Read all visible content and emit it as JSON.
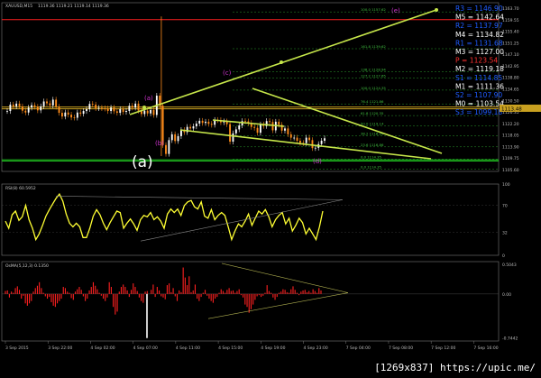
{
  "chart_data": [
    {
      "type": "candlestick",
      "panel": "price",
      "title": "XAUUSD,M15",
      "subtitle": "1119.36 1119.21 1119.14 1119.36",
      "ylim": [
        1105.0,
        1160.0
      ],
      "ticks_y": [
        "1163.70",
        "1159.55",
        "1155.40",
        "1151.25",
        "1147.10",
        "1142.95",
        "1138.80",
        "1134.65",
        "1130.50",
        "1126.35",
        "1122.20",
        "1118.05",
        "1113.90",
        "1109.75",
        "1105.60"
      ],
      "price_tag": "1113.48",
      "pivot_levels": [
        {
          "label": "R3 = 1146.90",
          "value": 1150.5,
          "color": "#1f5cff"
        },
        {
          "label": "M5 = 1142.64",
          "value": 1146.0,
          "color": "#ffffff"
        },
        {
          "label": "R2 = 1137.97",
          "value": 1141.3,
          "color": "#1f5cff"
        },
        {
          "label": "M4 = 1134.82",
          "value": 1138.0,
          "color": "#ffffff"
        },
        {
          "label": "R1 = 1131.68",
          "value": 1134.3,
          "color": "#1f5cff"
        },
        {
          "label": "M3 = 1127.00",
          "value": 1129.9,
          "color": "#ffffff"
        },
        {
          "label": "P = 1123.54",
          "value": 1126.5,
          "color": "#ff3030"
        },
        {
          "label": "M2 = 1119.18",
          "value": 1122.4,
          "color": "#ffffff"
        },
        {
          "label": "S1 = 1114.85",
          "value": 1118.6,
          "color": "#1f5cff"
        },
        {
          "label": "M1 = 1111.36",
          "value": 1114.4,
          "color": "#ffffff"
        },
        {
          "label": "S2 = 1107.90",
          "value": 1110.5,
          "color": "#1f5cff"
        },
        {
          "label": "M0 = 1103.54",
          "value": 1106.7,
          "color": "#ffffff"
        },
        {
          "label": "S3 = 1099.18",
          "value": 1102.7,
          "color": "#1f5cff"
        }
      ],
      "fib_levels": [
        {
          "label": "100.0 1157.62",
          "value": 1157.0
        },
        {
          "label": "161.8 1139.62",
          "value": 1145.0
        },
        {
          "label": "138.2 1128.94",
          "value": 1137.5
        },
        {
          "label": "127.2 1127.65",
          "value": 1135.5
        },
        {
          "label": "100.0 1124.35",
          "value": 1131.5
        },
        {
          "label": "76.4 1121.86",
          "value": 1127.0
        },
        {
          "label": "61.8 1120.35",
          "value": 1123.2
        },
        {
          "label": "50.0 1119.14",
          "value": 1119.8
        },
        {
          "label": "38.2 1118.04",
          "value": 1116.6
        },
        {
          "label": "23.6 1116.86",
          "value": 1113.0
        },
        {
          "label": "0.0 1114.35",
          "value": 1109.0
        },
        {
          "label": "0.0 1114.35",
          "value": 1105.8
        }
      ],
      "wave_labels": [
        "(a)",
        "(b)",
        "(c)",
        "(d)",
        "(e)",
        "(a)"
      ],
      "closes": [
        1124.7,
        1126.8,
        1126.2,
        1127.1,
        1126.2,
        1124.8,
        1124.2,
        1125.8,
        1126.6,
        1126.1,
        1124.9,
        1126.2,
        1127.8,
        1127.2,
        1126.5,
        1128.4,
        1126.1,
        1124.1,
        1122.9,
        1124.2,
        1123.5,
        1122.6,
        1122.5,
        1124.2,
        1123.8,
        1124.7,
        1125.3,
        1127.0,
        1126.8,
        1125.6,
        1125.7,
        1125.6,
        1125.5,
        1124.7,
        1125.8,
        1124.6,
        1124.1,
        1125.3,
        1124.4,
        1124.7,
        1126.4,
        1125.8,
        1127.1,
        1124.8,
        1123.7,
        1124.8,
        1123.9,
        1125.0,
        1123.4,
        1129.7,
        1126.4,
        1113.6,
        1110.7,
        1115.2,
        1117.1,
        1114.9,
        1116.5,
        1118.5,
        1117.8,
        1119.5,
        1119.0,
        1119.7,
        1120.6,
        1121.5,
        1120.8,
        1121.2,
        1120.5,
        1120.2,
        1121.8,
        1121.7,
        1121.0,
        1121.3,
        1120.4,
        1114.7,
        1117.4,
        1118.7,
        1120.0,
        1121.4,
        1121.3,
        1120.8,
        1119.5,
        1119.2,
        1117.6,
        1120.3,
        1119.8,
        1121.4,
        1121.1,
        1118.4,
        1121.2,
        1120.2,
        1118.3,
        1119.0,
        1117.1,
        1116.0,
        1116.0,
        1115.0,
        1114.3,
        1114.2,
        1116.0,
        1115.2,
        1112.6,
        1112.7,
        1113.9,
        1115.0,
        1115.8
      ],
      "highlight_levels": [
        {
          "label": "red",
          "value": 1154.5,
          "color": "#ff2020"
        },
        {
          "label": "olive",
          "value": 1125.4,
          "color": "#c8a020"
        },
        {
          "label": "olive2",
          "value": 1126.0,
          "color": "#c8a020"
        },
        {
          "label": "green",
          "value": 1108.8,
          "color": "#20c020"
        },
        {
          "label": "green2",
          "value": 1108.4,
          "color": "#20c020"
        }
      ]
    },
    {
      "type": "line",
      "panel": "rsi",
      "title": "RSI(8) 60.5952",
      "ylim": [
        0,
        100
      ],
      "ticks_y": [
        "100",
        "70",
        "32",
        "0"
      ],
      "values": [
        48,
        38,
        57,
        62,
        49,
        54,
        70,
        50,
        38,
        22,
        30,
        42,
        55,
        64,
        72,
        80,
        86,
        76,
        58,
        45,
        40,
        45,
        40,
        25,
        25,
        38,
        55,
        64,
        57,
        45,
        36,
        46,
        54,
        62,
        60,
        38,
        45,
        51,
        44,
        35,
        50,
        56,
        54,
        60,
        50,
        54,
        48,
        38,
        58,
        65,
        60,
        65,
        56,
        70,
        75,
        77,
        68,
        65,
        75,
        55,
        52,
        64,
        50,
        56,
        60,
        56,
        40,
        22,
        34,
        44,
        40,
        48,
        58,
        42,
        52,
        62,
        58,
        64,
        54,
        40,
        50,
        56,
        60,
        44,
        52,
        34,
        42,
        52,
        46,
        30,
        38,
        30,
        22,
        40,
        62
      ]
    },
    {
      "type": "bar",
      "panel": "macd",
      "title": "OsMA(5,12,3) 0.1350",
      "ylim": [
        -0.8,
        0.55
      ],
      "ticks_y": [
        "0.5043",
        "0.00",
        "-0.7442"
      ],
      "values": [
        0.05,
        0.06,
        -0.06,
        0.04,
        0.02,
        0.1,
        0.13,
        0.07,
        -0.08,
        -0.03,
        -0.16,
        -0.2,
        -0.16,
        -0.12,
        0.04,
        0.1,
        0.14,
        0.2,
        0.1,
        0.02,
        -0.04,
        -0.08,
        -0.05,
        -0.14,
        -0.2,
        -0.22,
        -0.16,
        -0.12,
        -0.08,
        0.12,
        0.1,
        0.04,
        0.02,
        -0.07,
        -0.1,
        0.04,
        0.08,
        0.12,
        0.07,
        -0.04,
        -0.12,
        -0.08,
        0.06,
        0.12,
        0.2,
        0.14,
        0.08,
        0.02,
        -0.03,
        -0.08,
        -0.12,
        -0.06,
        0.2,
        0.12,
        -0.22,
        -0.35,
        -0.3,
        0.04,
        0.12,
        0.16,
        0.12,
        0.06,
        -0.05,
        0.07,
        0.18,
        0.12,
        0.05,
        -0.06,
        -0.12,
        -0.15,
        0.04,
        0.05,
        0.0,
        0.07,
        0.16,
        -0.05,
        0.12,
        0.06,
        -0.04,
        -0.06,
        -0.09,
        0.15,
        0.18,
        0.03,
        0.1,
        -0.04,
        -0.12,
        0.06,
        0.03,
        0.45,
        0.28,
        0.15,
        0.3,
        0.03,
        0.06,
        0.16,
        -0.08,
        -0.12,
        -0.05,
        0.02,
        0.07,
        -0.03,
        -0.08,
        -0.12,
        -0.15,
        -0.08,
        -0.05,
        0.02,
        0.08,
        0.05,
        0.02,
        0.07,
        0.1,
        0.05,
        0.06,
        0.02,
        0.05,
        0.08,
        -0.02,
        -0.06,
        -0.18,
        -0.22,
        -0.32,
        -0.26,
        -0.18,
        -0.1,
        -0.04,
        -0.02,
        -0.05,
        -0.03,
        0.02,
        0.15,
        0.05,
        0.02,
        -0.06,
        -0.1,
        -0.05,
        0.02,
        0.04,
        0.08,
        0.07,
        0.03,
        0.02,
        0.08,
        0.13,
        0.07,
        0.02,
        -0.02,
        0.04,
        0.06,
        0.07,
        0.03,
        0.05,
        0.02,
        0.08,
        0.05,
        0.02,
        0.1,
        0.06
      ]
    }
  ],
  "x_axis": {
    "tick_labels": [
      "3 Sep 2015",
      "3 Sep 22:00",
      "4 Sep 02:00",
      "4 Sep 07:00",
      "4 Sep 11:00",
      "4 Sep 15:00",
      "4 Sep 19:00",
      "4 Sep 23:00",
      "7 Sep 04:00",
      "7 Sep 08:00",
      "7 Sep 12:00",
      "7 Sep 16:00"
    ]
  },
  "watermark": "[1269x837] https://upic.me/",
  "colors": {
    "bg": "#000000",
    "axis": "#7a7a7a",
    "candle_up": "#ffffff",
    "candle_down": "#ff8c1a",
    "trend": "#c6e64a",
    "wave_label": "#cc33cc",
    "rsi": "#ffff33",
    "macd": "#ff2020",
    "fib": "#2a9a2a"
  }
}
